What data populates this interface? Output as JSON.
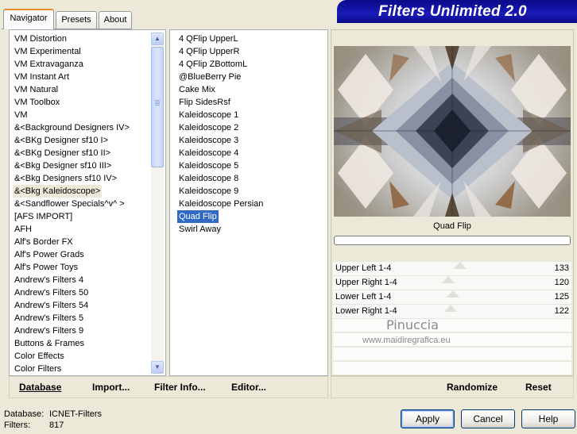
{
  "tabs": [
    {
      "label": "Navigator"
    },
    {
      "label": "Presets"
    },
    {
      "label": "About"
    }
  ],
  "banner": {
    "title": "Filters Unlimited 2.0"
  },
  "categories": {
    "items": [
      "VM Distortion",
      "VM Experimental",
      "VM Extravaganza",
      "VM Instant Art",
      "VM Natural",
      "VM Toolbox",
      "VM",
      "&<Background Designers IV>",
      "&<BKg Designer sf10 I>",
      "&<BKg Designer sf10 II>",
      "&<Bkg Designer sf10 III>",
      "&<Bkg Designers sf10 IV>",
      "&<Bkg Kaleidoscope>",
      "&<Sandflower Specials^v^ >",
      "[AFS IMPORT]",
      "AFH",
      "Alf's Border FX",
      "Alf's Power Grads",
      "Alf's Power Toys",
      "Andrew's Filters 4",
      "Andrew's Filters 50",
      "Andrew's Filters 54",
      "Andrew's Filters 5",
      "Andrew's Filters 9",
      "Buttons & Frames",
      "Color Effects",
      "Color Filters"
    ],
    "selected_index": 12
  },
  "filters": {
    "items": [
      "4 QFlip UpperL",
      "4 QFlip UpperR",
      "4 QFlip ZBottomL",
      "@BlueBerry Pie",
      "Cake Mix",
      "Flip SidesRsf",
      "Kaleidoscope 1",
      "Kaleidoscope 2",
      "Kaleidoscope 3",
      "Kaleidoscope 4",
      "Kaleidoscope 5",
      "Kaleidoscope 8",
      "Kaleidoscope 9",
      "Kaleidoscope Persian",
      "Quad Flip",
      "Swirl Away"
    ],
    "selected_index": 14
  },
  "preview": {
    "filter_name": "Quad Flip",
    "progress": 0
  },
  "params": [
    {
      "label": "Upper Left 1-4",
      "value": "133",
      "level": 0.52
    },
    {
      "label": "Upper Right 1-4",
      "value": "120",
      "level": 0.47
    },
    {
      "label": "Lower Left 1-4",
      "value": "125",
      "level": 0.49
    },
    {
      "label": "Lower Right 1-4",
      "value": "122",
      "level": 0.48
    }
  ],
  "watermark": {
    "name": "Pinuccia",
    "url": "www.maidiregrafica.eu"
  },
  "toolbar": {
    "database": "Database",
    "import": "Import...",
    "filter_info": "Filter Info...",
    "editor": "Editor...",
    "randomize": "Randomize",
    "reset": "Reset"
  },
  "status": {
    "database_label": "Database:",
    "database_value": "ICNET-Filters",
    "filters_label": "Filters:",
    "filters_value": "817"
  },
  "buttons": {
    "apply": "Apply",
    "cancel": "Cancel",
    "help": "Help"
  },
  "icons": {
    "scroll_up": "chevron-up-icon",
    "scroll_down": "chevron-down-icon"
  },
  "colors": {
    "banner": "#1b1bb8",
    "selection": "#316ac5",
    "tab_accent": "#e68b2c"
  }
}
